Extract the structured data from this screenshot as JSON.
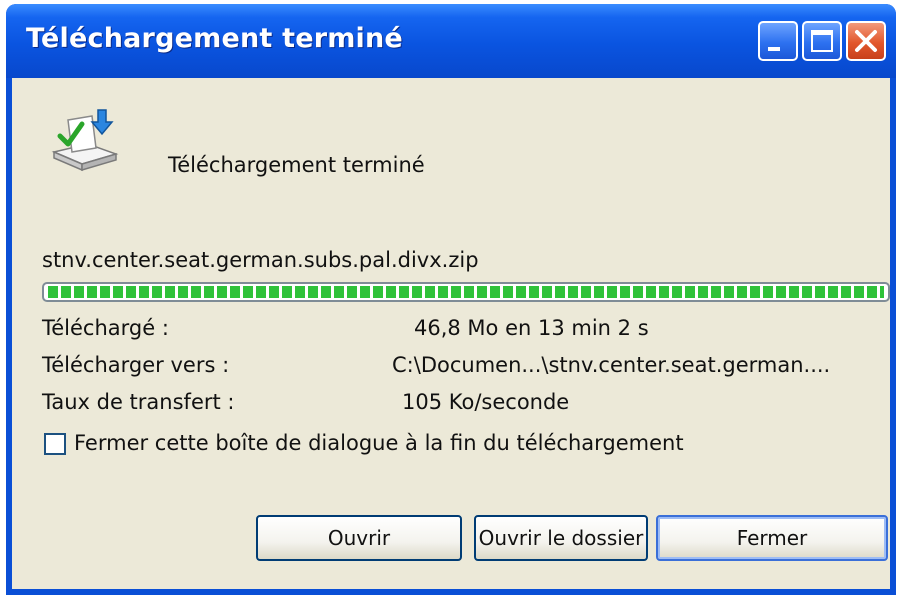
{
  "window": {
    "title": "Téléchargement terminé",
    "controls": {
      "minimize_icon": "minimize-icon",
      "maximize_icon": "maximize-icon",
      "close_icon": "close-icon"
    }
  },
  "header": {
    "icon": "download-complete-icon",
    "message": "Téléchargement terminé"
  },
  "file": {
    "name": "stnv.center.seat.german.subs.pal.divx.zip",
    "progress_fraction": 1.0,
    "progress_color": "#2fc23a"
  },
  "details": {
    "downloaded_label": "Téléchargé :",
    "downloaded_value": "46,8 Mo en 13 min 2 s",
    "destination_label": "Télécharger vers :",
    "destination_value": "C:\\Documen...\\stnv.center.seat.german....",
    "rate_label": "Taux de transfert :",
    "rate_value": "105 Ko/seconde"
  },
  "options": {
    "close_when_done_label": "Fermer cette boîte de dialogue à la fin du téléchargement",
    "close_when_done_checked": false
  },
  "buttons": {
    "open": "Ouvrir",
    "open_folder": "Ouvrir le dossier",
    "close": "Fermer"
  }
}
